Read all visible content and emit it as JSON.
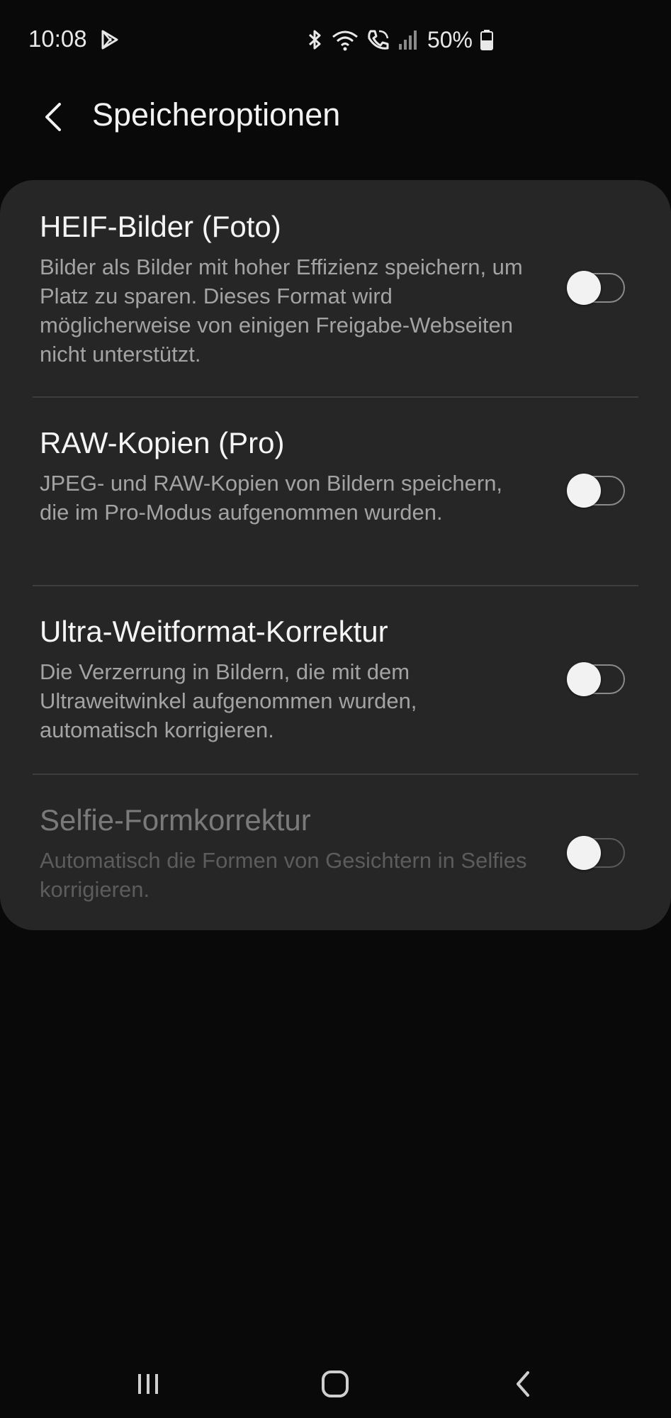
{
  "status_bar": {
    "time": "10:08",
    "battery": "50%",
    "icons": [
      "play-store-icon",
      "bluetooth-icon",
      "wifi-icon",
      "wifi-call-icon",
      "signal-icon",
      "battery-icon"
    ]
  },
  "header": {
    "title": "Speicheroptionen",
    "back_icon": "chevron-left-icon"
  },
  "settings": [
    {
      "title": "HEIF-Bilder (Foto)",
      "description": "Bilder als Bilder mit hoher Effizienz speichern, um Platz zu sparen. Dieses Format wird möglicherweise von einigen Freigabe-Webseiten nicht unterstützt.",
      "enabled": false,
      "disabled": false
    },
    {
      "title": "RAW-Kopien (Pro)",
      "description": "JPEG- und RAW-Kopien von Bildern speichern, die im Pro-Modus aufgenommen wurden.",
      "enabled": false,
      "disabled": false
    },
    {
      "title": "Ultra-Weitformat-Korrektur",
      "description": "Die Verzerrung in Bildern, die mit dem Ultraweitwinkel aufgenommen wurden, automatisch korrigieren.",
      "enabled": false,
      "disabled": false
    },
    {
      "title": "Selfie-Formkorrektur",
      "description": "Automatisch die Formen von Gesichtern in Selfies korrigieren.",
      "enabled": false,
      "disabled": true
    }
  ],
  "nav_bar": {
    "icons": [
      "recent-apps-icon",
      "home-icon",
      "back-icon"
    ]
  },
  "colors": {
    "background": "#090909",
    "card": "#262626",
    "title_text": "#f5f5f5",
    "description_text": "#a3a3a3",
    "disabled_text": "#7a7a7a",
    "divider": "#3d3d3d"
  }
}
